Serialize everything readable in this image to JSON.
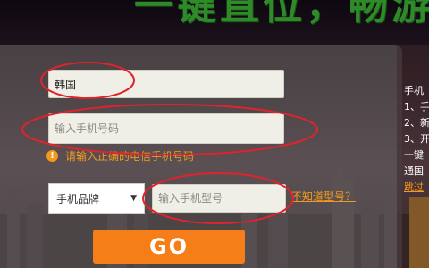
{
  "banner": {
    "headline": "一键直位，畅游全"
  },
  "form": {
    "country_value": "韩国",
    "phone_placeholder": "输入手机号码",
    "hint_text": "请输入正确的电信手机号码",
    "brand_label": "手机品牌",
    "model_placeholder": "输入手机型号",
    "unknown_model_link": "不知道型号？",
    "go_label": "GO"
  },
  "side_info": {
    "lines": [
      "手机",
      "1、手",
      "2、新",
      "3、开",
      "一键",
      "通国"
    ],
    "skip_link": "跳过"
  },
  "colors": {
    "accent": "#f57e18",
    "hint": "#f39a1d",
    "annotation": "#e0232c",
    "headline": "#2f8a2a"
  }
}
